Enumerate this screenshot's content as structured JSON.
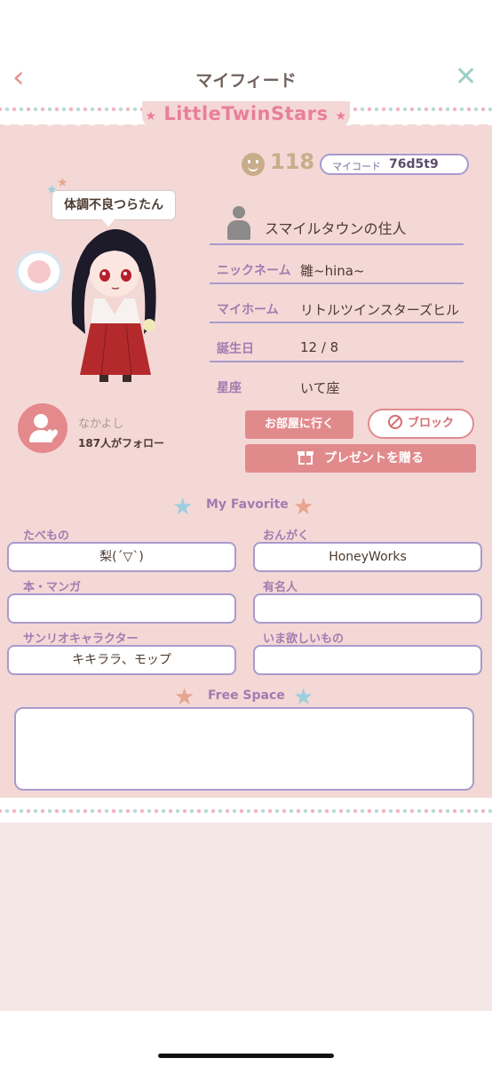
{
  "header": {
    "title": "マイフィード",
    "back_icon": "chevron-left-icon",
    "close_icon": "close-icon"
  },
  "brand": {
    "logo_text": "LittleTwinStars"
  },
  "profile": {
    "smile_count": "118",
    "code_label": "マイコード",
    "code_value": "76d5t9",
    "status_bubble": "体調不良つらたん",
    "title": "スマイルタウンの住人",
    "fields": [
      {
        "label": "ニックネーム",
        "value": "雛~hina~"
      },
      {
        "label": "マイホーム",
        "value": "リトルツインスターズヒル"
      },
      {
        "label": "誕生日",
        "value": "12 / 8"
      },
      {
        "label": "星座",
        "value": "いて座"
      }
    ]
  },
  "friend": {
    "label": "なかよし",
    "follow_count": "187人がフォロー"
  },
  "actions": {
    "room_button": "お部屋に行く",
    "block_button": "ブロック",
    "gift_button": "プレゼントを贈る"
  },
  "favorites": {
    "heading": "My Favorite",
    "items": [
      {
        "label": "たべもの",
        "value": "梨(´▽`)"
      },
      {
        "label": "おんがく",
        "value": "HoneyWorks"
      },
      {
        "label": "本・マンガ",
        "value": ""
      },
      {
        "label": "有名人",
        "value": ""
      },
      {
        "label": "サンリオキャラクター",
        "value": "キキララ、モップ"
      },
      {
        "label": "いま欲しいもの",
        "value": ""
      }
    ]
  },
  "free_space": {
    "heading": "Free Space",
    "text": ""
  },
  "colors": {
    "accent_pink": "#e18a8c",
    "lavender": "#a99acd",
    "background": "#f4d8d6",
    "logo_pink": "#e87f9b"
  }
}
